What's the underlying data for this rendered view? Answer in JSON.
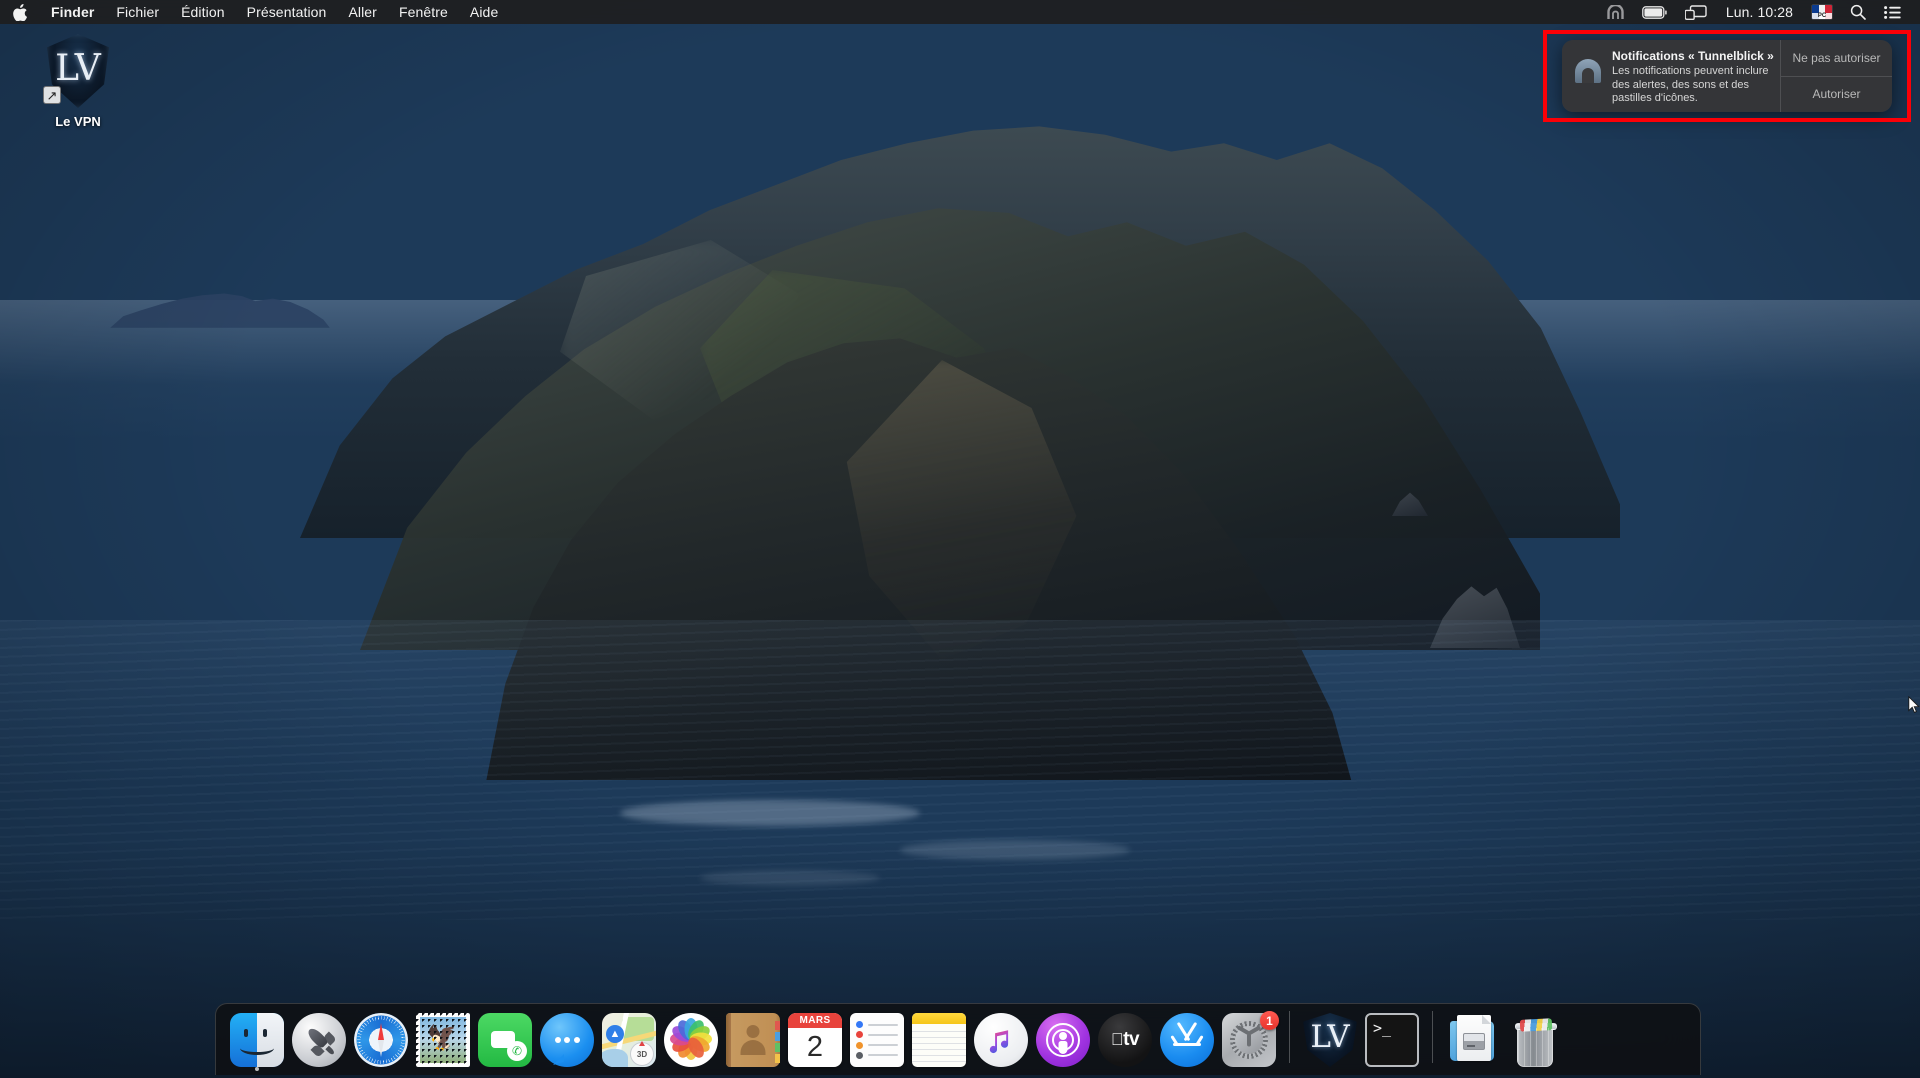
{
  "menubar": {
    "apple_icon": "apple-logo-icon",
    "items": [
      {
        "label": "Finder",
        "bold": true
      },
      {
        "label": "Fichier",
        "bold": false
      },
      {
        "label": "Édition",
        "bold": false
      },
      {
        "label": "Présentation",
        "bold": false
      },
      {
        "label": "Aller",
        "bold": false
      },
      {
        "label": "Fenêtre",
        "bold": false
      },
      {
        "label": "Aide",
        "bold": false
      }
    ],
    "status": {
      "vpn_icon": "tunnelblick-tunnel-icon",
      "battery_icon": "battery-icon",
      "airplay_icon": "screen-mirroring-icon",
      "clock": "Lun. 10:28",
      "input_source": "PC",
      "input_flag": "french-flag-icon",
      "search_icon": "spotlight-search-icon",
      "control_center_icon": "control-center-icon"
    }
  },
  "desktop": {
    "icon": {
      "label": "Le VPN",
      "monogram": "LV",
      "glyph_name": "le-vpn-shield-icon",
      "alias_arrow": "↗"
    }
  },
  "notification": {
    "app_icon": "tunnelblick-icon",
    "title": "Notifications « Tunnelblick »",
    "message": "Les notifications peuvent inclure des alertes, des sons et des pastilles d'icônes.",
    "buttons": {
      "deny": "Ne pas autoriser",
      "allow": "Autoriser"
    },
    "highlight_color": "#fb0007"
  },
  "dock": {
    "items": [
      {
        "name": "finder",
        "kind": "app",
        "label": "Finder",
        "running": true
      },
      {
        "name": "launchpad",
        "kind": "app",
        "label": "Launchpad",
        "running": false
      },
      {
        "name": "safari",
        "kind": "app",
        "label": "Safari",
        "running": false
      },
      {
        "name": "mail",
        "kind": "app",
        "label": "Mail",
        "running": false
      },
      {
        "name": "facetime",
        "kind": "app",
        "label": "FaceTime",
        "running": false
      },
      {
        "name": "messages",
        "kind": "app",
        "label": "Messages",
        "running": false
      },
      {
        "name": "maps",
        "kind": "app",
        "label": "Plans",
        "running": false
      },
      {
        "name": "photos",
        "kind": "app",
        "label": "Photos",
        "running": false
      },
      {
        "name": "contacts",
        "kind": "app",
        "label": "Contacts",
        "running": false
      },
      {
        "name": "calendar",
        "kind": "app",
        "label": "Calendrier",
        "running": false,
        "month": "MARS",
        "day": "2"
      },
      {
        "name": "reminders",
        "kind": "app",
        "label": "Rappels",
        "running": false
      },
      {
        "name": "notes",
        "kind": "app",
        "label": "Notes",
        "running": false
      },
      {
        "name": "music",
        "kind": "app",
        "label": "Musique",
        "running": false
      },
      {
        "name": "podcasts",
        "kind": "app",
        "label": "Podcasts",
        "running": false
      },
      {
        "name": "appletv",
        "kind": "app",
        "label": "Apple TV",
        "running": false,
        "text": "tv"
      },
      {
        "name": "appstore",
        "kind": "app",
        "label": "App Store",
        "running": false
      },
      {
        "name": "system-prefs",
        "kind": "app",
        "label": "Préférences Système",
        "running": false,
        "badge": "1"
      },
      {
        "name": "separator-1",
        "kind": "separator"
      },
      {
        "name": "levpn",
        "kind": "app",
        "label": "Le VPN",
        "running": false,
        "monogram": "LV"
      },
      {
        "name": "terminal",
        "kind": "app",
        "label": "Terminal",
        "running": false,
        "prompt": ">_"
      },
      {
        "name": "separator-2",
        "kind": "separator"
      },
      {
        "name": "downloads",
        "kind": "stack",
        "label": "Téléchargements",
        "running": false
      },
      {
        "name": "trash",
        "kind": "stack",
        "label": "Corbeille",
        "running": false
      }
    ]
  },
  "colors": {
    "menubar_bg": "#1e1e20",
    "dock_bg": "#0e0e10",
    "notification_bg": "#363638",
    "highlight_red": "#fb0007",
    "accent_blue": "#1a8cf0"
  }
}
